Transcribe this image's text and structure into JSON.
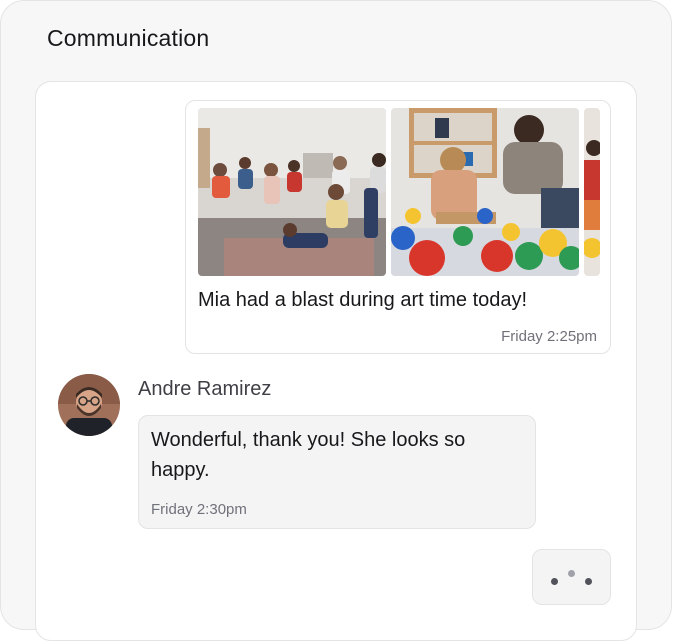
{
  "panel": {
    "title": "Communication"
  },
  "messages": [
    {
      "direction": "outgoing",
      "photos": [
        {
          "icon": "classroom-photo",
          "description_for_agent": "photo-1"
        },
        {
          "icon": "classroom-photo",
          "description_for_agent": "photo-2"
        },
        {
          "icon": "classroom-photo",
          "description_for_agent": "photo-3"
        }
      ],
      "text": "Mia had a blast during art time today!",
      "time": "Friday 2:25pm"
    },
    {
      "direction": "incoming",
      "sender": "Andre Ramirez",
      "avatar_icon": "avatar-photo",
      "text": "Wonderful, thank you! She looks so happy.",
      "time": "Friday 2:30pm"
    }
  ],
  "typing_indicator": {
    "icon": "typing-dots-icon",
    "dot_colors": [
      "#52525b",
      "#a1a1aa",
      "#52525b"
    ]
  },
  "colors": {
    "panel_bg": "#f7f7f8",
    "card_bg": "#ffffff",
    "bubble_in_bg": "#f4f4f5",
    "border": "#e4e4e7",
    "text_primary": "#18181b",
    "text_muted": "#71717a"
  }
}
